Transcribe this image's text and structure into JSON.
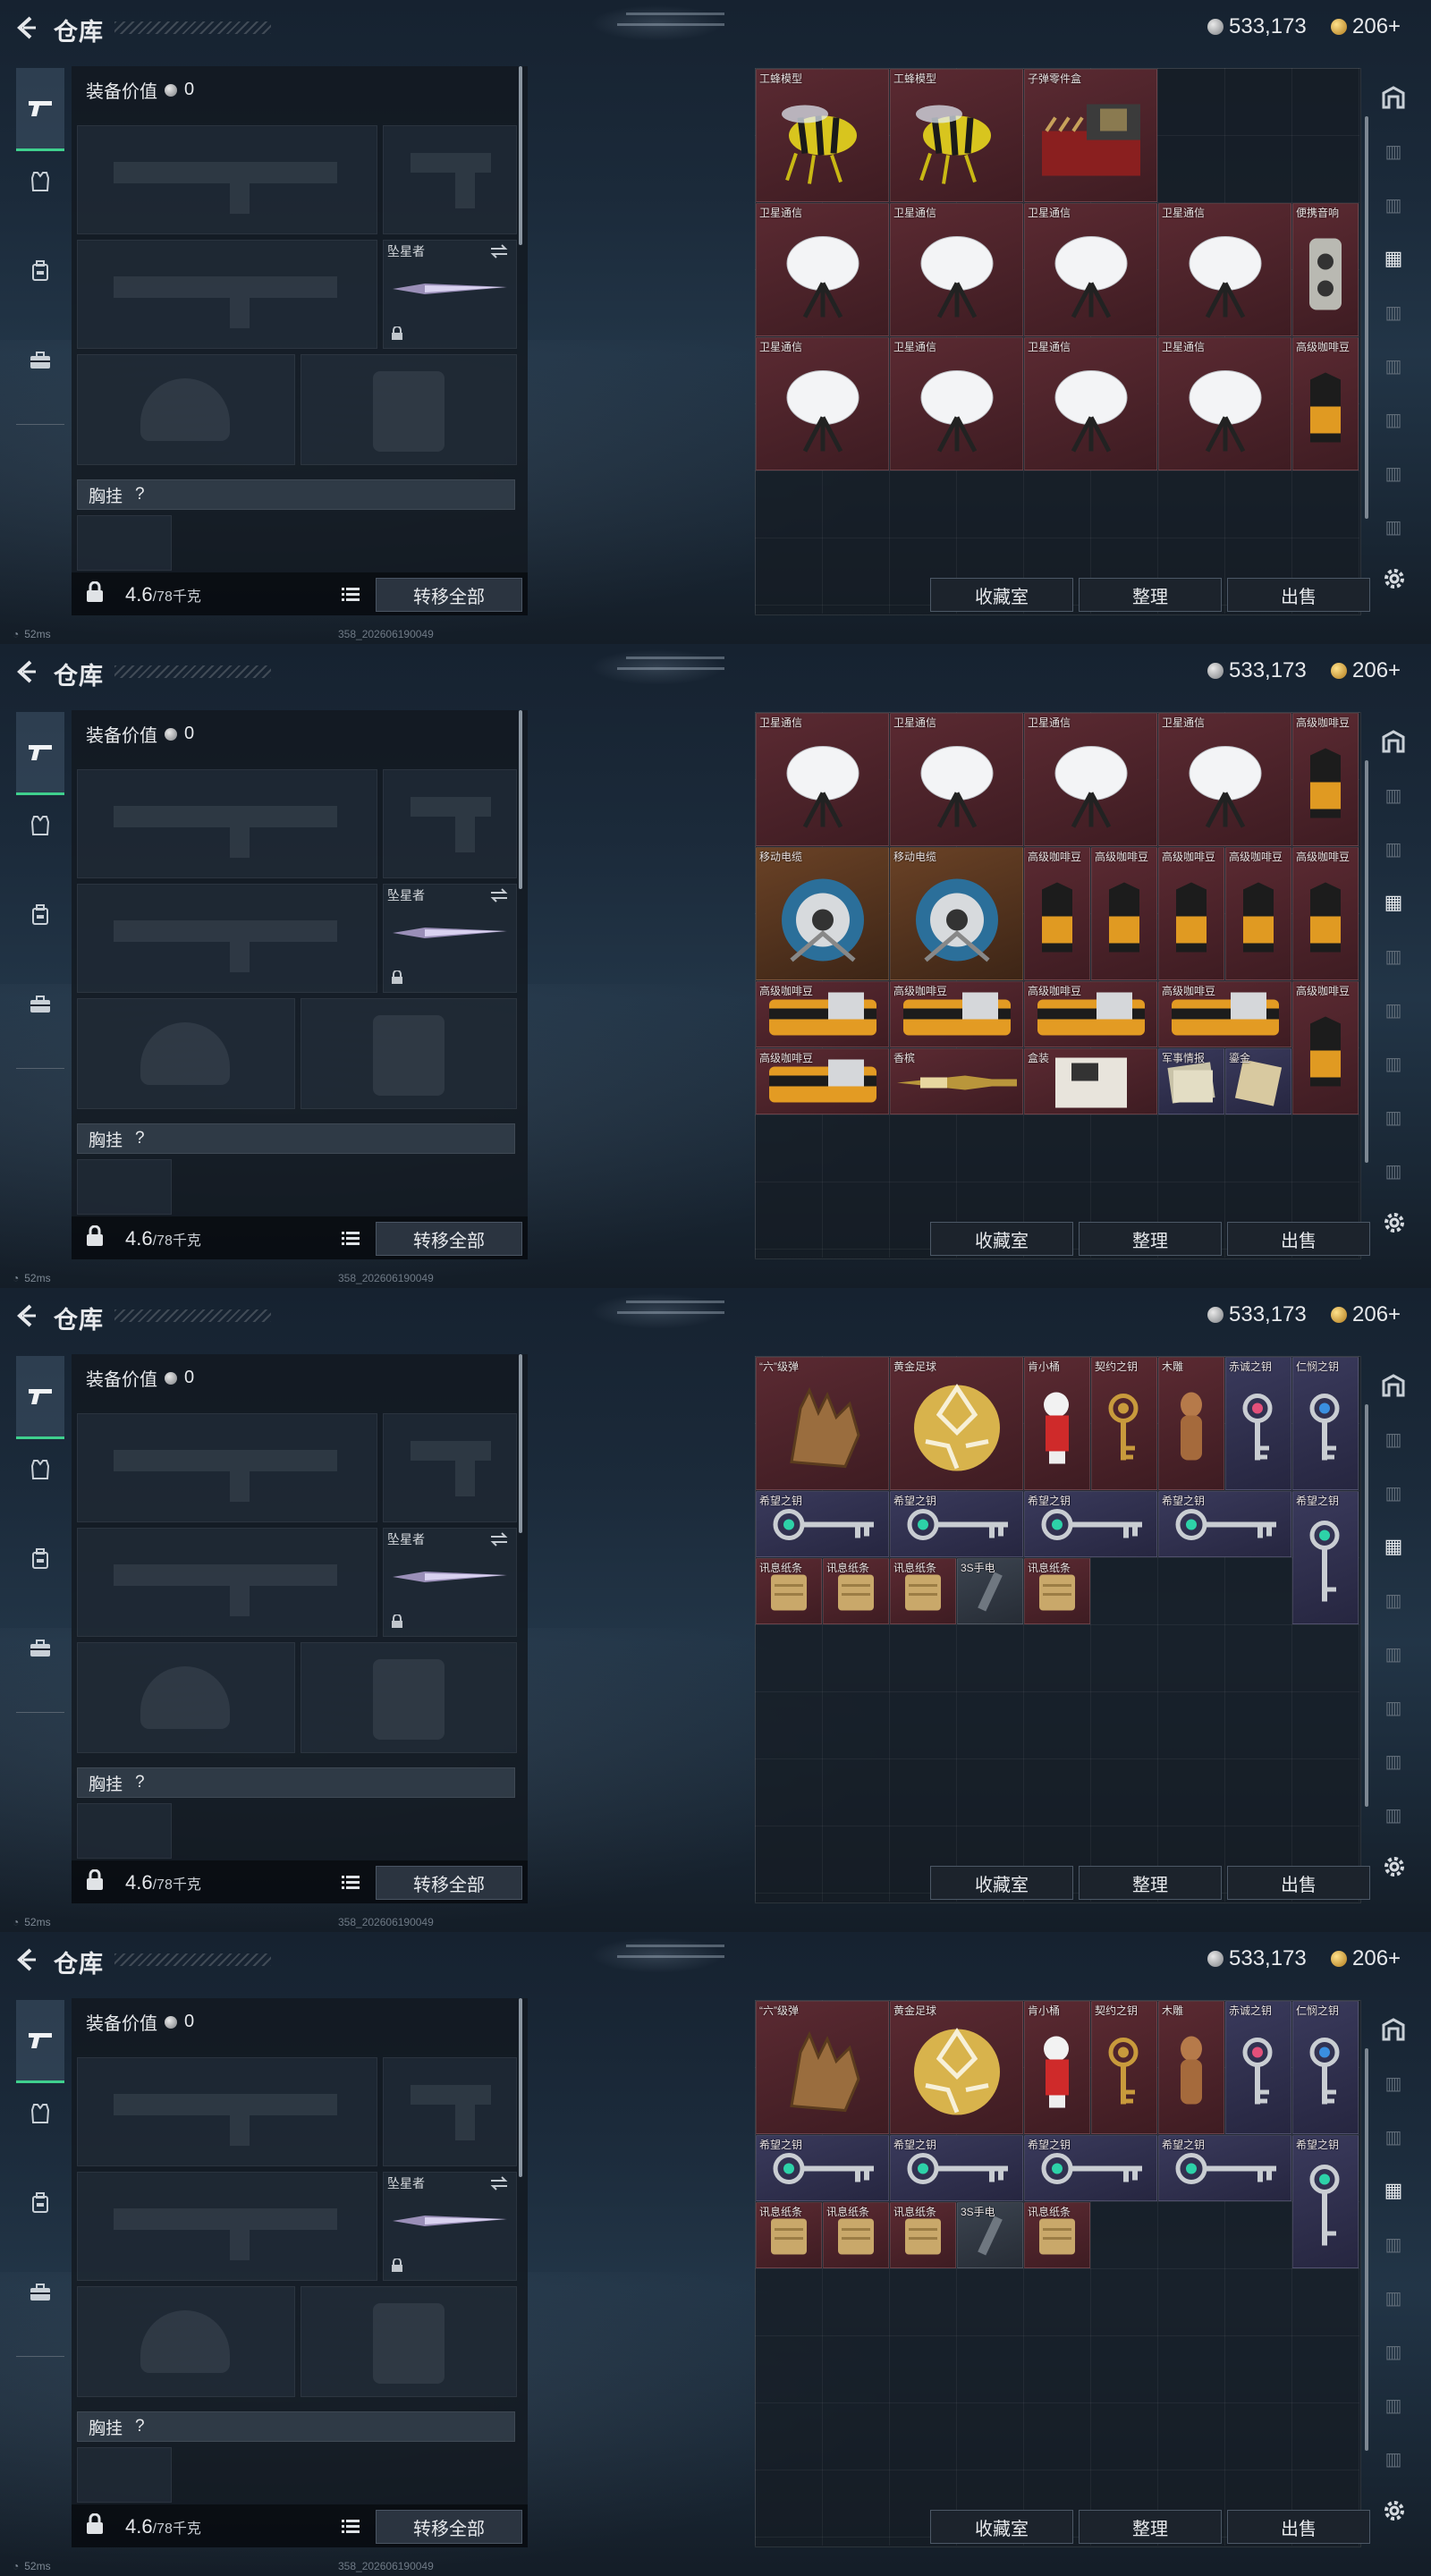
{
  "header": {
    "title": "仓库",
    "currency_silver": "533,173",
    "currency_gold": "206+"
  },
  "loadout": {
    "value_label": "装备价值",
    "value": "0",
    "melee_name": "坠星者",
    "chest_label": "胸挂",
    "chest_hint": "?",
    "weight": "4.6",
    "weight_max": "/78千克",
    "transfer_all": "转移全部"
  },
  "actions": {
    "collection": "收藏室",
    "organize": "整理",
    "sell": "出售"
  },
  "status": {
    "ping": "52ms",
    "build": "358_202606190049"
  },
  "screens": [
    {
      "items": [
        {
          "label": "工蜂模型",
          "color": "red",
          "icon": "bee-model-icon",
          "col": 0,
          "row": 0,
          "w": 2,
          "h": 2
        },
        {
          "label": "工蜂模型",
          "color": "red",
          "icon": "bee-model-icon",
          "col": 2,
          "row": 0,
          "w": 2,
          "h": 2
        },
        {
          "label": "子弹零件盒",
          "color": "red",
          "icon": "ammo-parts-box-icon",
          "col": 4,
          "row": 0,
          "w": 2,
          "h": 2
        },
        {
          "label": "卫星通信",
          "color": "red",
          "icon": "satellite-dish-icon",
          "col": 0,
          "row": 2,
          "w": 2,
          "h": 2
        },
        {
          "label": "卫星通信",
          "color": "red",
          "icon": "satellite-dish-icon",
          "col": 2,
          "row": 2,
          "w": 2,
          "h": 2
        },
        {
          "label": "卫星通信",
          "color": "red",
          "icon": "satellite-dish-icon",
          "col": 4,
          "row": 2,
          "w": 2,
          "h": 2
        },
        {
          "label": "卫星通信",
          "color": "red",
          "icon": "satellite-dish-icon",
          "col": 6,
          "row": 2,
          "w": 2,
          "h": 2
        },
        {
          "label": "便携音响",
          "color": "red",
          "icon": "portable-speaker-icon",
          "col": 8,
          "row": 2,
          "w": 1,
          "h": 2
        },
        {
          "label": "卫星通信",
          "color": "red",
          "icon": "satellite-dish-icon",
          "col": 0,
          "row": 4,
          "w": 2,
          "h": 2
        },
        {
          "label": "卫星通信",
          "color": "red",
          "icon": "satellite-dish-icon",
          "col": 2,
          "row": 4,
          "w": 2,
          "h": 2
        },
        {
          "label": "卫星通信",
          "color": "red",
          "icon": "satellite-dish-icon",
          "col": 4,
          "row": 4,
          "w": 2,
          "h": 2
        },
        {
          "label": "卫星通信",
          "color": "red",
          "icon": "satellite-dish-icon",
          "col": 6,
          "row": 4,
          "w": 2,
          "h": 2
        },
        {
          "label": "高级咖啡豆",
          "color": "red",
          "icon": "coffee-bean-bag-icon",
          "col": 8,
          "row": 4,
          "w": 1,
          "h": 2
        }
      ]
    },
    {
      "items": [
        {
          "label": "卫星通信",
          "color": "red",
          "icon": "satellite-dish-icon",
          "col": 0,
          "row": 0,
          "w": 2,
          "h": 2
        },
        {
          "label": "卫星通信",
          "color": "red",
          "icon": "satellite-dish-icon",
          "col": 2,
          "row": 0,
          "w": 2,
          "h": 2
        },
        {
          "label": "卫星通信",
          "color": "red",
          "icon": "satellite-dish-icon",
          "col": 4,
          "row": 0,
          "w": 2,
          "h": 2
        },
        {
          "label": "卫星通信",
          "color": "red",
          "icon": "satellite-dish-icon",
          "col": 6,
          "row": 0,
          "w": 2,
          "h": 2
        },
        {
          "label": "高级咖啡豆",
          "color": "red",
          "icon": "coffee-bean-bag-icon",
          "col": 8,
          "row": 0,
          "w": 1,
          "h": 2
        },
        {
          "label": "移动电缆",
          "color": "orange",
          "icon": "cable-reel-icon",
          "col": 0,
          "row": 2,
          "w": 2,
          "h": 2
        },
        {
          "label": "移动电缆",
          "color": "orange",
          "icon": "cable-reel-icon",
          "col": 2,
          "row": 2,
          "w": 2,
          "h": 2
        },
        {
          "label": "高级咖啡豆",
          "color": "red",
          "icon": "coffee-bean-bag-icon",
          "col": 4,
          "row": 2,
          "w": 1,
          "h": 2
        },
        {
          "label": "高级咖啡豆",
          "color": "red",
          "icon": "coffee-bean-bag-icon",
          "col": 5,
          "row": 2,
          "w": 1,
          "h": 2
        },
        {
          "label": "高级咖啡豆",
          "color": "red",
          "icon": "coffee-bean-bag-icon",
          "col": 6,
          "row": 2,
          "w": 1,
          "h": 2
        },
        {
          "label": "高级咖啡豆",
          "color": "red",
          "icon": "coffee-bean-bag-icon",
          "col": 7,
          "row": 2,
          "w": 1,
          "h": 2
        },
        {
          "label": "高级咖啡豆",
          "color": "red",
          "icon": "coffee-bean-bag-icon",
          "col": 8,
          "row": 2,
          "w": 1,
          "h": 2
        },
        {
          "label": "高级咖啡豆",
          "color": "red",
          "icon": "coffee-tin-icon",
          "col": 0,
          "row": 4,
          "w": 2,
          "h": 1
        },
        {
          "label": "高级咖啡豆",
          "color": "red",
          "icon": "coffee-tin-icon",
          "col": 2,
          "row": 4,
          "w": 2,
          "h": 1
        },
        {
          "label": "高级咖啡豆",
          "color": "red",
          "icon": "coffee-tin-icon",
          "col": 4,
          "row": 4,
          "w": 2,
          "h": 1
        },
        {
          "label": "高级咖啡豆",
          "color": "red",
          "icon": "coffee-tin-icon",
          "col": 6,
          "row": 4,
          "w": 2,
          "h": 1
        },
        {
          "label": "高级咖啡豆",
          "color": "red",
          "icon": "coffee-bean-bag-icon",
          "col": 8,
          "row": 4,
          "w": 1,
          "h": 2
        },
        {
          "label": "高级咖啡豆",
          "color": "red",
          "icon": "coffee-tin-icon",
          "col": 0,
          "row": 5,
          "w": 2,
          "h": 1
        },
        {
          "label": "香槟",
          "color": "red",
          "icon": "champagne-bottle-icon",
          "col": 2,
          "row": 5,
          "w": 2,
          "h": 1
        },
        {
          "label": "盒装",
          "color": "red",
          "icon": "boxed-item-icon",
          "col": 4,
          "row": 5,
          "w": 2,
          "h": 1
        },
        {
          "label": "军事情报",
          "color": "purple",
          "icon": "intel-documents-icon",
          "col": 6,
          "row": 5,
          "w": 1,
          "h": 1
        },
        {
          "label": "鎏金",
          "color": "purple",
          "icon": "gilded-item-icon",
          "col": 7,
          "row": 5,
          "w": 1,
          "h": 1
        }
      ]
    },
    {
      "items": [
        {
          "label": "“六”级弹",
          "color": "red",
          "icon": "six-gesture-hand-icon",
          "col": 0,
          "row": 0,
          "w": 2,
          "h": 2
        },
        {
          "label": "黄金足球",
          "color": "red",
          "icon": "golden-football-icon",
          "col": 2,
          "row": 0,
          "w": 2,
          "h": 2
        },
        {
          "label": "肯小桶",
          "color": "red",
          "icon": "colonel-figurine-icon",
          "col": 4,
          "row": 0,
          "w": 1,
          "h": 2
        },
        {
          "label": "契约之钥",
          "color": "red",
          "icon": "ornate-key-icon",
          "col": 5,
          "row": 0,
          "w": 1,
          "h": 2
        },
        {
          "label": "木雕",
          "color": "red",
          "icon": "wood-carving-icon",
          "col": 6,
          "row": 0,
          "w": 1,
          "h": 2
        },
        {
          "label": "赤诚之钥",
          "color": "purple",
          "icon": "ruby-key-icon",
          "col": 7,
          "row": 0,
          "w": 1,
          "h": 2
        },
        {
          "label": "仁悯之钥",
          "color": "purple",
          "icon": "sapphire-key-icon",
          "col": 8,
          "row": 0,
          "w": 1,
          "h": 2
        },
        {
          "label": "希望之钥",
          "color": "purple",
          "icon": "hope-key-icon",
          "col": 0,
          "row": 2,
          "w": 2,
          "h": 1
        },
        {
          "label": "希望之钥",
          "color": "purple",
          "icon": "hope-key-icon",
          "col": 2,
          "row": 2,
          "w": 2,
          "h": 1
        },
        {
          "label": "希望之钥",
          "color": "purple",
          "icon": "hope-key-icon",
          "col": 4,
          "row": 2,
          "w": 2,
          "h": 1
        },
        {
          "label": "希望之钥",
          "color": "purple",
          "icon": "hope-key-icon",
          "col": 6,
          "row": 2,
          "w": 2,
          "h": 1
        },
        {
          "label": "希望之钥",
          "color": "purple",
          "icon": "hope-key-vertical-icon",
          "col": 8,
          "row": 2,
          "w": 1,
          "h": 2
        },
        {
          "label": "讯息纸条",
          "color": "red",
          "icon": "message-note-icon",
          "col": 0,
          "row": 3,
          "w": 1,
          "h": 1
        },
        {
          "label": "讯息纸条",
          "color": "red",
          "icon": "message-note-icon",
          "col": 1,
          "row": 3,
          "w": 1,
          "h": 1
        },
        {
          "label": "讯息纸条",
          "color": "red",
          "icon": "message-note-icon",
          "col": 2,
          "row": 3,
          "w": 1,
          "h": 1
        },
        {
          "label": "3S手电",
          "color": "gray",
          "icon": "flashlight-icon",
          "col": 3,
          "row": 3,
          "w": 1,
          "h": 1
        },
        {
          "label": "讯息纸条",
          "color": "red",
          "icon": "message-note-icon",
          "col": 4,
          "row": 3,
          "w": 1,
          "h": 1
        }
      ]
    },
    {
      "items": [
        {
          "label": "“六”级弹",
          "color": "red",
          "icon": "six-gesture-hand-icon",
          "col": 0,
          "row": 0,
          "w": 2,
          "h": 2
        },
        {
          "label": "黄金足球",
          "color": "red",
          "icon": "golden-football-icon",
          "col": 2,
          "row": 0,
          "w": 2,
          "h": 2
        },
        {
          "label": "肯小桶",
          "color": "red",
          "icon": "colonel-figurine-icon",
          "col": 4,
          "row": 0,
          "w": 1,
          "h": 2
        },
        {
          "label": "契约之钥",
          "color": "red",
          "icon": "ornate-key-icon",
          "col": 5,
          "row": 0,
          "w": 1,
          "h": 2
        },
        {
          "label": "木雕",
          "color": "red",
          "icon": "wood-carving-icon",
          "col": 6,
          "row": 0,
          "w": 1,
          "h": 2
        },
        {
          "label": "赤诚之钥",
          "color": "purple",
          "icon": "ruby-key-icon",
          "col": 7,
          "row": 0,
          "w": 1,
          "h": 2
        },
        {
          "label": "仁悯之钥",
          "color": "purple",
          "icon": "sapphire-key-icon",
          "col": 8,
          "row": 0,
          "w": 1,
          "h": 2
        },
        {
          "label": "希望之钥",
          "color": "purple",
          "icon": "hope-key-icon",
          "col": 0,
          "row": 2,
          "w": 2,
          "h": 1
        },
        {
          "label": "希望之钥",
          "color": "purple",
          "icon": "hope-key-icon",
          "col": 2,
          "row": 2,
          "w": 2,
          "h": 1
        },
        {
          "label": "希望之钥",
          "color": "purple",
          "icon": "hope-key-icon",
          "col": 4,
          "row": 2,
          "w": 2,
          "h": 1
        },
        {
          "label": "希望之钥",
          "color": "purple",
          "icon": "hope-key-icon",
          "col": 6,
          "row": 2,
          "w": 2,
          "h": 1
        },
        {
          "label": "希望之钥",
          "color": "purple",
          "icon": "hope-key-vertical-icon",
          "col": 8,
          "row": 2,
          "w": 1,
          "h": 2
        },
        {
          "label": "讯息纸条",
          "color": "red",
          "icon": "message-note-icon",
          "col": 0,
          "row": 3,
          "w": 1,
          "h": 1
        },
        {
          "label": "讯息纸条",
          "color": "red",
          "icon": "message-note-icon",
          "col": 1,
          "row": 3,
          "w": 1,
          "h": 1
        },
        {
          "label": "讯息纸条",
          "color": "red",
          "icon": "message-note-icon",
          "col": 2,
          "row": 3,
          "w": 1,
          "h": 1
        },
        {
          "label": "3S手电",
          "color": "gray",
          "icon": "flashlight-icon",
          "col": 3,
          "row": 3,
          "w": 1,
          "h": 1
        },
        {
          "label": "讯息纸条",
          "color": "red",
          "icon": "message-note-icon",
          "col": 4,
          "row": 3,
          "w": 1,
          "h": 1
        }
      ]
    }
  ],
  "colors": {
    "accent_green": "#3fd08e",
    "rarity_red": "#5b2a32",
    "rarity_purple": "#3a3a5c",
    "rarity_orange": "#6a4226"
  }
}
